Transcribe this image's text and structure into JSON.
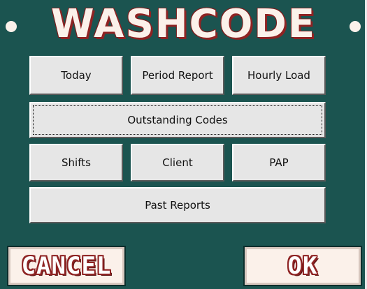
{
  "title": "WASHCODE",
  "buttons": {
    "today": "Today",
    "period_report": "Period Report",
    "hourly_load": "Hourly Load",
    "outstanding_codes": "Outstanding Codes",
    "shifts": "Shifts",
    "client": "Client",
    "pap": "PAP",
    "past_reports": "Past Reports",
    "cancel": "CANCEL",
    "ok": "OK"
  },
  "colors": {
    "background": "#1b5450",
    "title_fill": "#fbf1ea",
    "title_outline": "#8e2323",
    "button_face": "#e6e6e6"
  }
}
